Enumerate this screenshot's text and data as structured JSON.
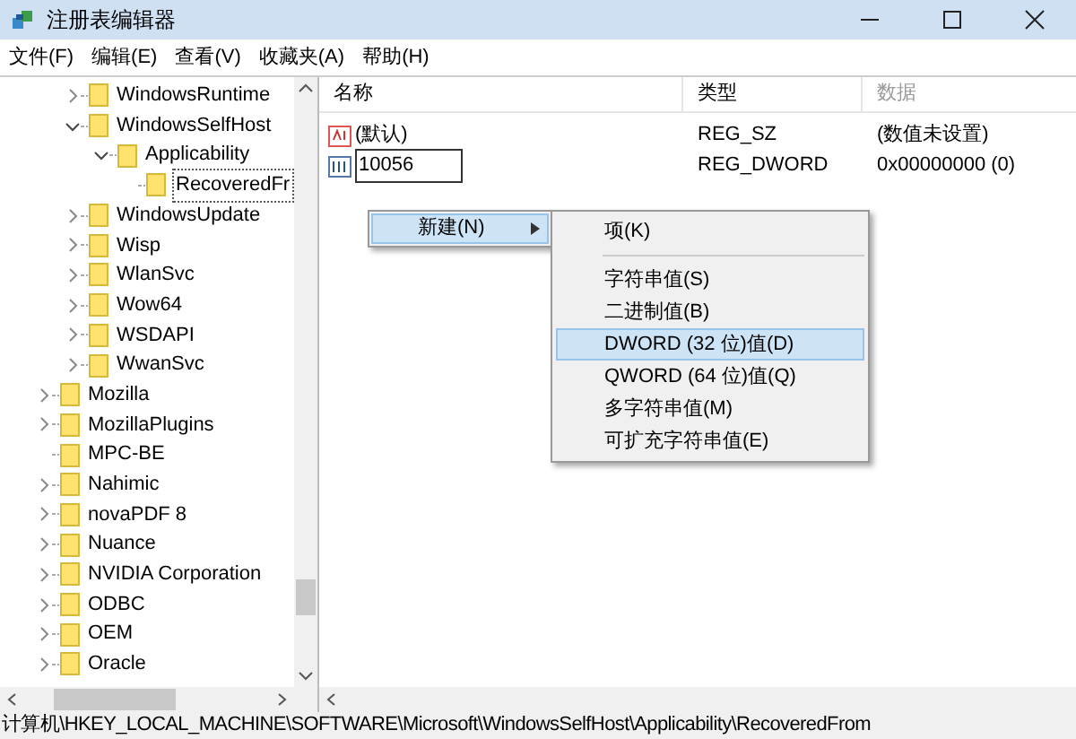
{
  "window": {
    "title": "注册表编辑器"
  },
  "menu": [
    "文件(F)",
    "编辑(E)",
    "查看(V)",
    "收藏夹(A)",
    "帮助(H)"
  ],
  "tree": {
    "nested_items": [
      {
        "label": "WindowsRuntime",
        "expanded": false,
        "has_children": true
      },
      {
        "label": "WindowsSelfHost",
        "expanded": true,
        "has_children": true,
        "children": [
          {
            "label": "Applicability",
            "expanded": true,
            "has_children": true,
            "children": [
              {
                "label": "RecoveredFr",
                "selected": true,
                "has_children": false
              }
            ]
          }
        ]
      },
      {
        "label": "WindowsUpdate",
        "expanded": false,
        "has_children": true
      },
      {
        "label": "Wisp",
        "expanded": false,
        "has_children": true
      },
      {
        "label": "WlanSvc",
        "expanded": false,
        "has_children": true
      },
      {
        "label": "Wow64",
        "expanded": false,
        "has_children": true
      },
      {
        "label": "WSDAPI",
        "expanded": false,
        "has_children": true
      },
      {
        "label": "WwanSvc",
        "expanded": false,
        "has_children": true
      }
    ],
    "items": [
      {
        "label": "Mozilla",
        "expanded": false,
        "has_children": true
      },
      {
        "label": "MozillaPlugins",
        "expanded": false,
        "has_children": true
      },
      {
        "label": "MPC-BE",
        "expanded": false,
        "has_children": false
      },
      {
        "label": "Nahimic",
        "expanded": false,
        "has_children": true
      },
      {
        "label": "novaPDF 8",
        "expanded": false,
        "has_children": true
      },
      {
        "label": "Nuance",
        "expanded": false,
        "has_children": true
      },
      {
        "label": "NVIDIA Corporation",
        "expanded": false,
        "has_children": true
      },
      {
        "label": "ODBC",
        "expanded": false,
        "has_children": true
      },
      {
        "label": "OEM",
        "expanded": false,
        "has_children": true
      },
      {
        "label": "Oracle",
        "expanded": false,
        "has_children": true
      }
    ]
  },
  "values": {
    "columns": [
      "名称",
      "类型",
      "数据"
    ],
    "rows": [
      {
        "kind": "string",
        "name": "(默认)",
        "editing": false,
        "type": "REG_SZ",
        "data": "(数值未设置)"
      },
      {
        "kind": "binary",
        "name": "10056",
        "editing": true,
        "type": "REG_DWORD",
        "data": "0x00000000 (0)"
      }
    ]
  },
  "context_menu": {
    "items": [
      {
        "label": "新建(N)",
        "selected": true,
        "submenu": true
      }
    ]
  },
  "submenu": {
    "groups": [
      [
        {
          "label": "项(K)",
          "selected": false
        }
      ],
      [
        {
          "label": "字符串值(S)",
          "selected": false
        },
        {
          "label": "二进制值(B)",
          "selected": false
        },
        {
          "label": "DWORD (32 位)值(D)",
          "selected": true
        },
        {
          "label": "QWORD (64 位)值(Q)",
          "selected": false
        },
        {
          "label": "多字符串值(M)",
          "selected": false
        },
        {
          "label": "可扩充字符串值(E)",
          "selected": false
        }
      ]
    ]
  },
  "status_bar": "计算机\\HKEY_LOCAL_MACHINE\\SOFTWARE\\Microsoft\\WindowsSelfHost\\Applicability\\RecoveredFrom"
}
